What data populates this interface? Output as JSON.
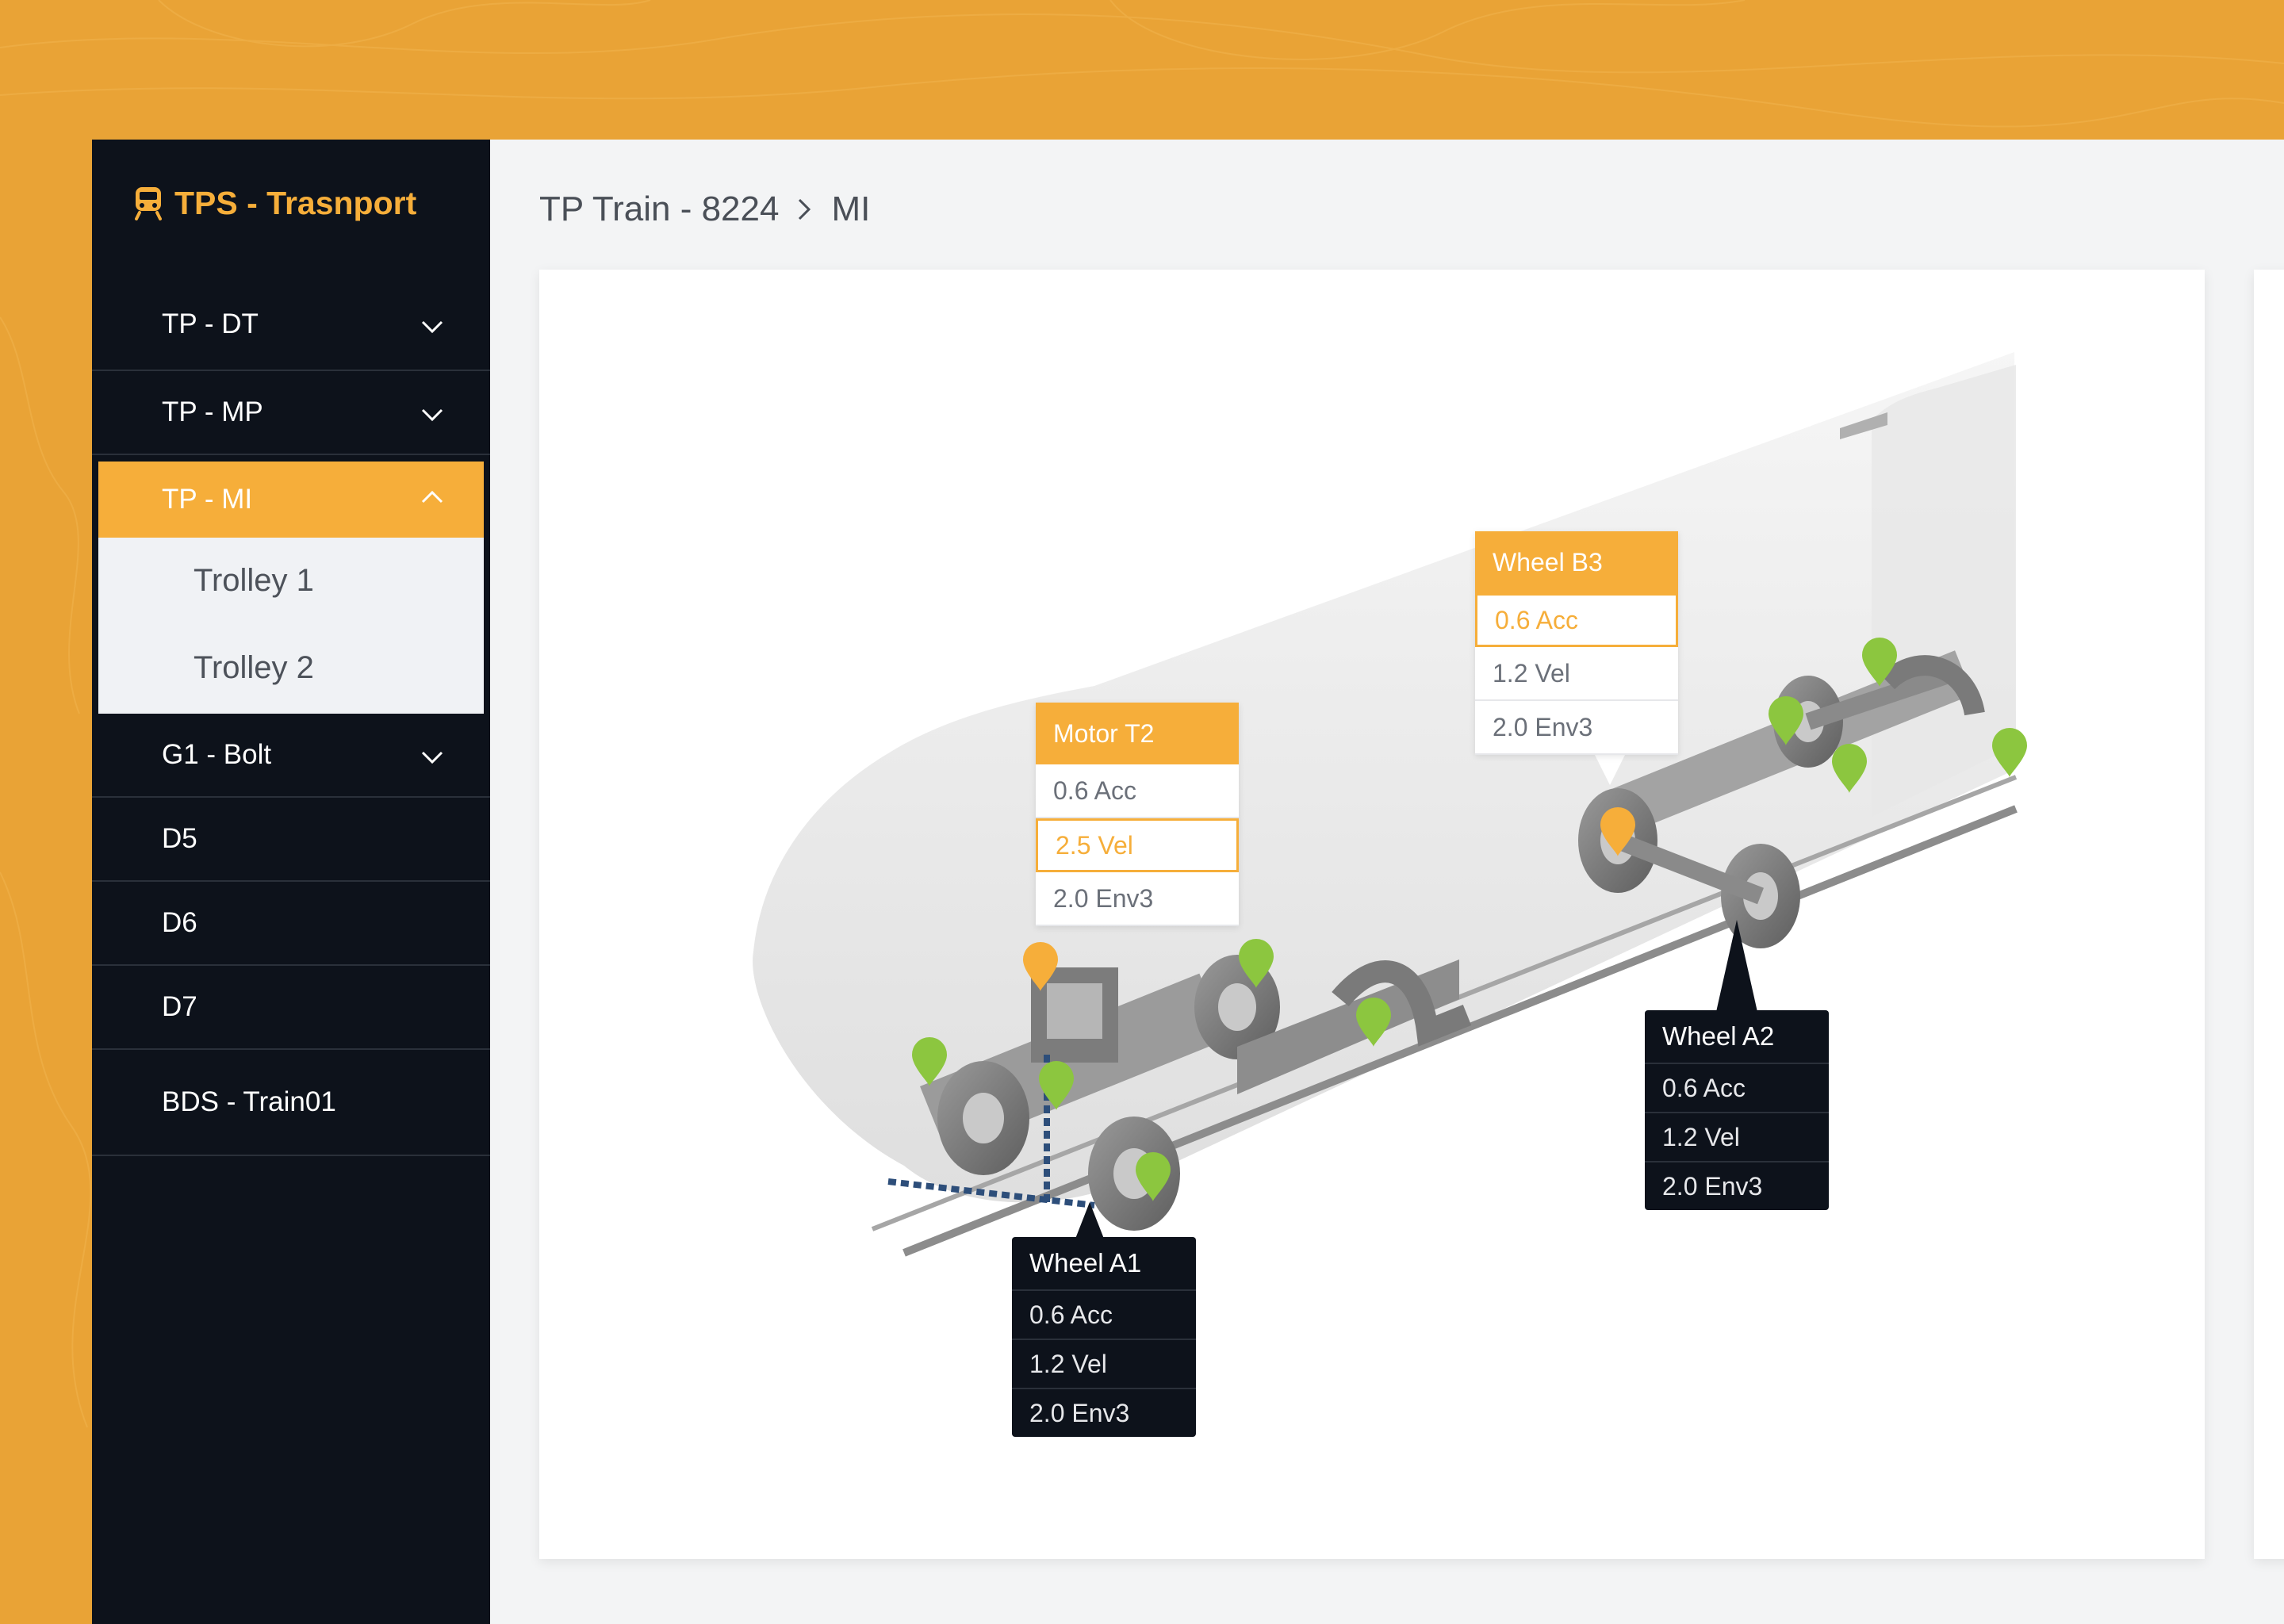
{
  "brand": {
    "name": "TPS - Trasnport",
    "icon": "train-icon",
    "color": "#F6AE3A"
  },
  "sidebar": {
    "items": [
      {
        "label": "TP - DT",
        "expandable": true,
        "expanded": false
      },
      {
        "label": "TP - MP",
        "expandable": true,
        "expanded": false
      },
      {
        "label": "TP - MI",
        "expandable": true,
        "expanded": true,
        "active": true,
        "children": [
          {
            "label": "Trolley 1"
          },
          {
            "label": "Trolley 2"
          }
        ]
      },
      {
        "label": "G1 - Bolt",
        "expandable": true,
        "expanded": false
      },
      {
        "label": "D5"
      },
      {
        "label": "D6"
      },
      {
        "label": "D7"
      },
      {
        "label": "BDS - Train01"
      }
    ]
  },
  "breadcrumb": {
    "parent": "TP Train - 8224",
    "current": "MI"
  },
  "callouts": {
    "motor_t2": {
      "title": "Motor T2",
      "rows": [
        "0.6 Acc",
        "2.5 Vel",
        "2.0 Env3"
      ],
      "selected": 1
    },
    "wheel_b3": {
      "title": "Wheel B3",
      "rows": [
        "0.6 Acc",
        "1.2 Vel",
        "2.0 Env3"
      ],
      "selected": 0
    },
    "wheel_a2": {
      "title": "Wheel A2",
      "rows": [
        "0.6 Acc",
        "1.2 Vel",
        "2.0 Env3"
      ]
    },
    "wheel_a1": {
      "title": "Wheel A1",
      "rows": [
        "0.6 Acc",
        "1.2 Vel",
        "2.0 Env3"
      ]
    }
  },
  "colors": {
    "accent": "#F6AE3A",
    "sidebar": "#0D121B",
    "sensor_ok": "#8CC63F",
    "sensor_warn": "#F6AE3A",
    "background": "#E9A336"
  }
}
